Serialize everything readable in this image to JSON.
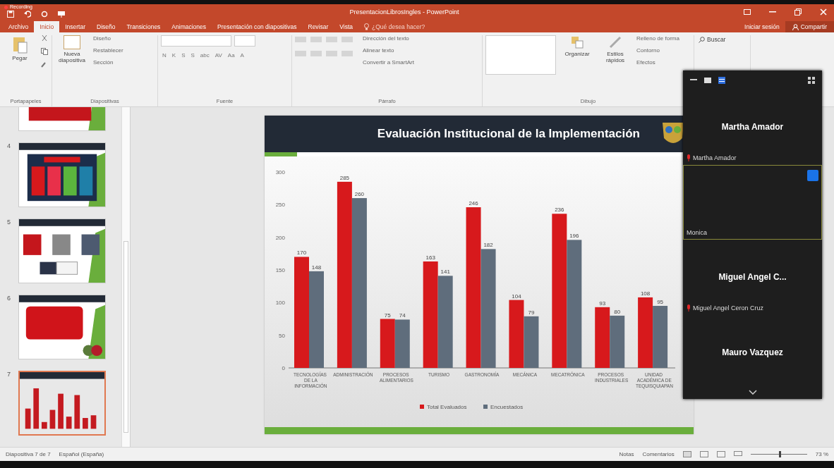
{
  "recording": "Recording",
  "window": {
    "title": "PresentacionLibrosIngles - PowerPoint"
  },
  "tabs": [
    {
      "label": "Archivo",
      "selected": false
    },
    {
      "label": "Inicio",
      "selected": true
    },
    {
      "label": "Insertar",
      "selected": false
    },
    {
      "label": "Diseño",
      "selected": false
    },
    {
      "label": "Transiciones",
      "selected": false
    },
    {
      "label": "Animaciones",
      "selected": false
    },
    {
      "label": "Presentación con diapositivas",
      "selected": false
    },
    {
      "label": "Revisar",
      "selected": false
    },
    {
      "label": "Vista",
      "selected": false
    }
  ],
  "tell_me": "¿Qué desea hacer?",
  "account": {
    "sign_in": "Iniciar sesión",
    "share": "Compartir"
  },
  "ribbon": {
    "paste": "Pegar",
    "new_slide": "Nueva diapositiva",
    "slide_items": [
      "Diseño",
      "Restablecer",
      "Sección"
    ],
    "font_buttons": [
      "N",
      "K",
      "S",
      "S",
      "abc",
      "AV",
      "Aa",
      "A"
    ],
    "paragraph_items": [
      "Dirección del texto",
      "Alinear texto",
      "Convertir a SmartArt"
    ],
    "arrange": "Organizar",
    "quick_styles": "Estilos rápidos",
    "shape_items": [
      "Relleno de forma",
      "Contorno",
      "Efectos"
    ],
    "find": "Buscar",
    "groups": [
      "Portapapeles",
      "Diapositivas",
      "Fuente",
      "Párrafo",
      "Dibujo"
    ]
  },
  "thumbnails": [
    {
      "kind": "banner",
      "selected": false
    },
    {
      "number": "4",
      "kind": "cards",
      "selected": false
    },
    {
      "number": "5",
      "kind": "flow",
      "selected": false
    },
    {
      "number": "6",
      "kind": "text",
      "selected": false
    },
    {
      "number": "7",
      "kind": "chart",
      "selected": true
    }
  ],
  "slide": {
    "title": "Evaluación Institucional de la Implementación",
    "chart_data": {
      "type": "bar",
      "categories": [
        "TECNOLOGÍAS DE LA INFORMACIÓN",
        "ADMINISTRACIÓN",
        "PROCESOS ALIMENTARIOS",
        "TURISMO",
        "GASTRONOMÍA",
        "MECÁNICA",
        "MECATRÓNICA",
        "PROCESOS INDUSTRIALES",
        "UNIDAD ACADÉMICA DE TEQUISQUIAPAN"
      ],
      "series": [
        {
          "name": "Total Evaluados",
          "color": "#d7191c",
          "values": [
            170,
            285,
            75,
            163,
            246,
            104,
            236,
            93,
            108
          ]
        },
        {
          "name": "Encuestados",
          "color": "#5f6d7c",
          "values": [
            148,
            260,
            74,
            141,
            182,
            79,
            196,
            80,
            95
          ]
        }
      ],
      "ylim": [
        0,
        300
      ],
      "yticks": [
        0,
        50,
        100,
        150,
        200,
        250,
        300
      ],
      "data_labels": true,
      "legend": true
    }
  },
  "meeting": {
    "tiles": [
      {
        "big_name": "Martha Amador",
        "label": "Martha Amador",
        "muted": true,
        "selected": false
      },
      {
        "label": "Monica",
        "selected": true
      },
      {
        "big_name": "Miguel Angel C...",
        "label": "Miguel Angel Ceron Cruz",
        "muted": true,
        "selected": false
      },
      {
        "big_name": "Mauro Vazquez",
        "selected": false
      }
    ]
  },
  "status_bar": {
    "slide": "Diapositiva 7 de 7",
    "language": "Español (España)",
    "notes": "Notas",
    "comments": "Comentarios",
    "zoom": "73 %",
    "zoom_slider": {
      "level": 0.5
    }
  }
}
